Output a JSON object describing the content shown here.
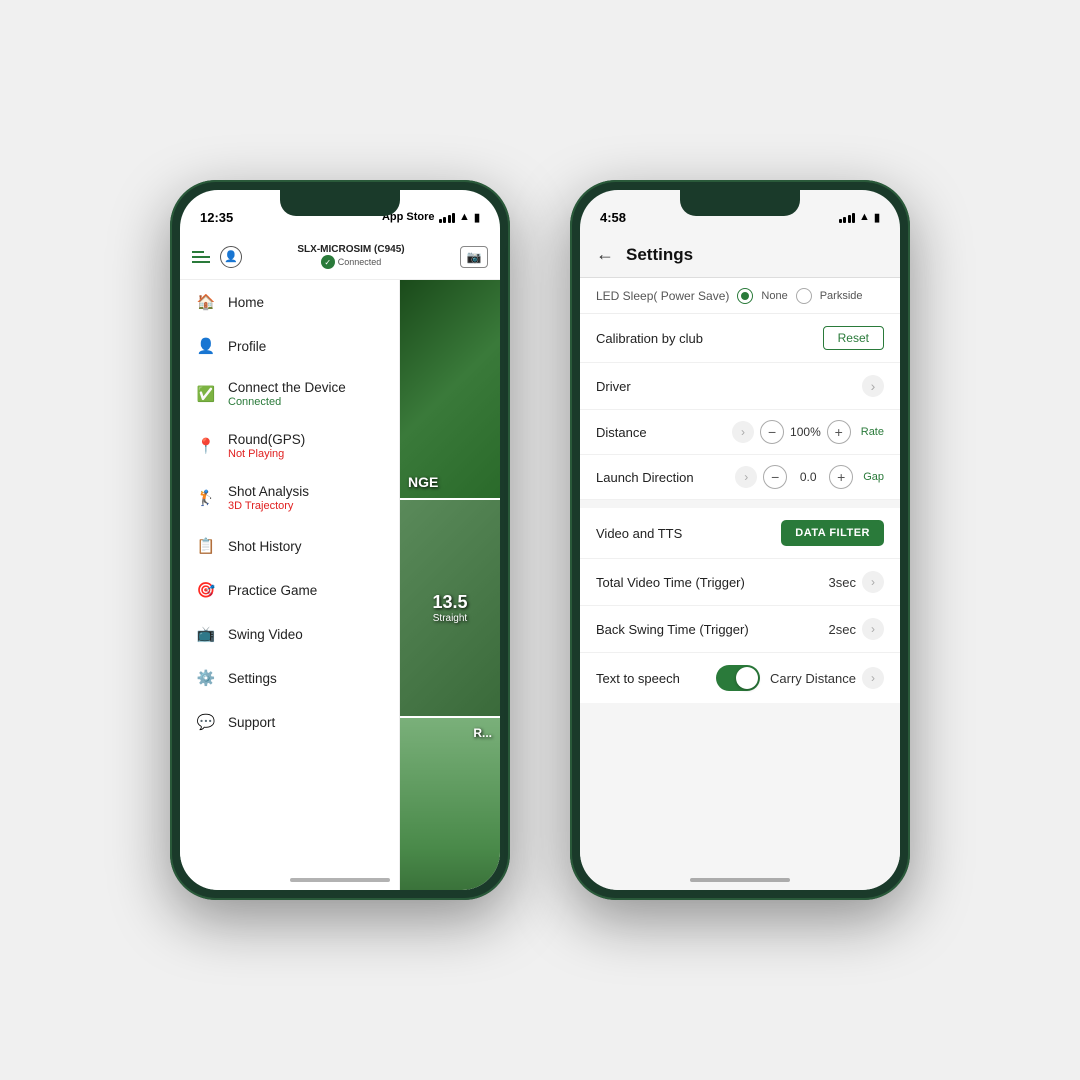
{
  "phone1": {
    "time": "12:35",
    "carrier": "App Store",
    "device_name": "SLX-MICROSIM (C945)",
    "device_status": "Connected",
    "nav_items": [
      {
        "id": "home",
        "icon": "🏠",
        "label": "Home",
        "sublabel": ""
      },
      {
        "id": "profile",
        "icon": "👤",
        "label": "Profile",
        "sublabel": ""
      },
      {
        "id": "connect",
        "icon": "✅",
        "label": "Connect the Device",
        "sublabel": "Connected",
        "sublabel_color": "green"
      },
      {
        "id": "round",
        "icon": "📍",
        "label": "Round(GPS)",
        "sublabel": "Not Playing",
        "sublabel_color": "red"
      },
      {
        "id": "shot-analysis",
        "icon": "🏌️",
        "label": "Shot Analysis",
        "sublabel": "3D Trajectory",
        "sublabel_color": "red"
      },
      {
        "id": "shot-history",
        "icon": "📋",
        "label": "Shot History",
        "sublabel": ""
      },
      {
        "id": "practice-game",
        "icon": "🎯",
        "label": "Practice Game",
        "sublabel": ""
      },
      {
        "id": "swing-video",
        "icon": "📺",
        "label": "Swing Video",
        "sublabel": ""
      },
      {
        "id": "settings",
        "icon": "⚙️",
        "label": "Settings",
        "sublabel": ""
      },
      {
        "id": "support",
        "icon": "💬",
        "label": "Support",
        "sublabel": ""
      }
    ]
  },
  "phone2": {
    "time": "4:58",
    "title": "Settings",
    "led_sleep_label": "LED Sleep( Power Save)",
    "led_option1": "None",
    "led_option2": "Parkside",
    "calibration_label": "Calibration by club",
    "reset_label": "Reset",
    "driver_label": "Driver",
    "distance_label": "Distance",
    "distance_value": "100%",
    "distance_suffix": "Rate",
    "launch_label": "Launch Direction",
    "launch_value": "0.0",
    "launch_suffix": "Gap",
    "video_tts_label": "Video and TTS",
    "data_filter_label": "DATA FILTER",
    "total_video_label": "Total Video Time (Trigger)",
    "total_video_value": "3sec",
    "back_swing_label": "Back Swing Time (Trigger)",
    "back_swing_value": "2sec",
    "tts_label": "Text to speech",
    "carry_label": "Carry Distance",
    "back_label": "←"
  }
}
